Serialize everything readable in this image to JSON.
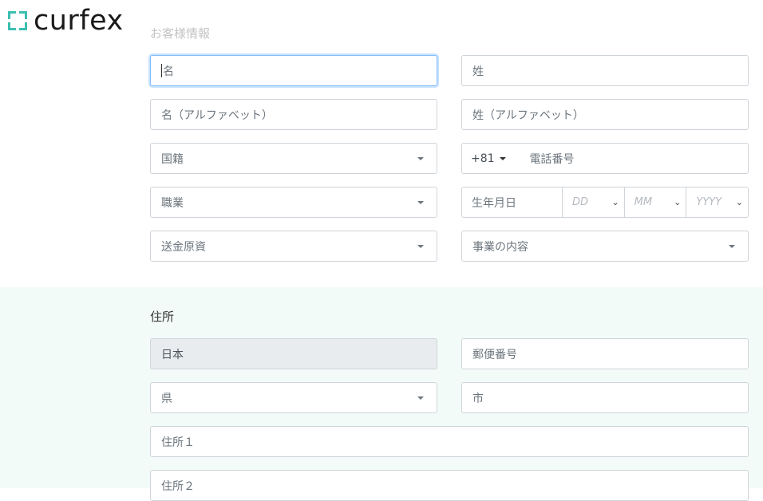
{
  "brand": {
    "logo_text": "curfex",
    "accent": "#3bbfb0"
  },
  "customer_section": {
    "title": "お客様情報",
    "first_name_placeholder": "名",
    "last_name_placeholder": "姓",
    "first_name_alpha_placeholder": "名（アルファベット）",
    "last_name_alpha_placeholder": "姓（アルファベット）",
    "nationality_placeholder": "国籍",
    "phone_country_code": "+81",
    "phone_placeholder": "電話番号",
    "occupation_placeholder": "職業",
    "dob_label": "生年月日",
    "dob_day": "DD",
    "dob_month": "MM",
    "dob_year": "YYYY",
    "fund_source_placeholder": "送金原資",
    "business_placeholder": "事業の内容"
  },
  "address_section": {
    "title": "住所",
    "country_value": "日本",
    "postal_placeholder": "郵便番号",
    "prefecture_placeholder": "県",
    "city_placeholder": "市",
    "address1_placeholder": "住所１",
    "address2_placeholder": "住所２"
  }
}
